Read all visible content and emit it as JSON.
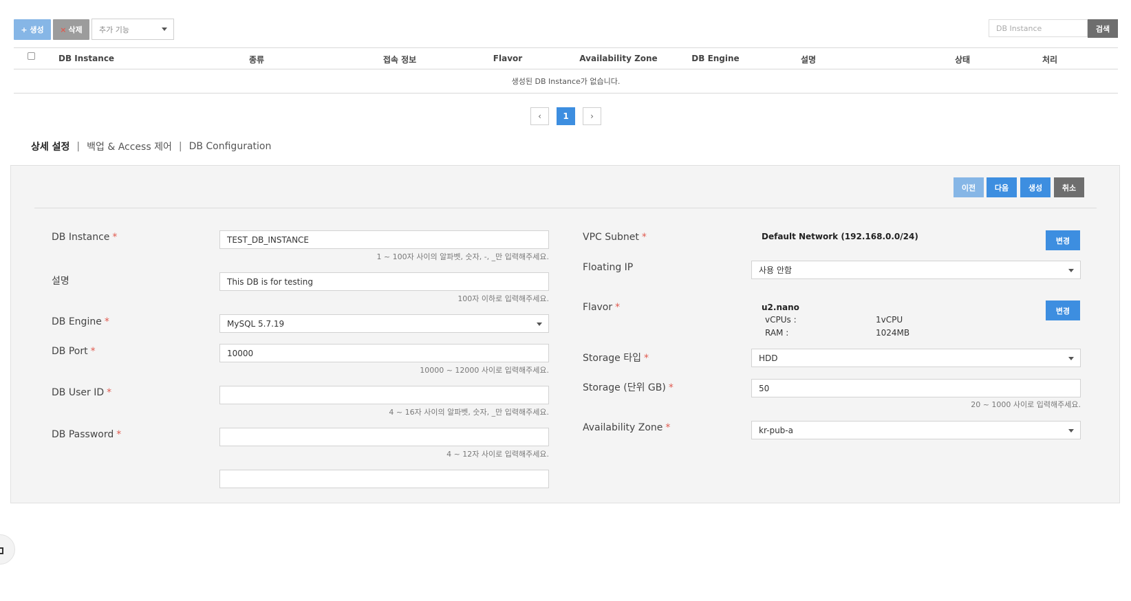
{
  "toolbar": {
    "create_label": "+ 생성",
    "delete_label": "삭제",
    "delete_x": "×",
    "extra_select": "추가 기능",
    "search_placeholder": "DB Instance",
    "search_button": "검색"
  },
  "table": {
    "columns": [
      "DB Instance",
      "종류",
      "접속 정보",
      "Flavor",
      "Availability Zone",
      "DB Engine",
      "설명",
      "상태",
      "처리"
    ],
    "empty_message": "생성된 DB Instance가 없습니다."
  },
  "pagination": {
    "prev": "‹",
    "current": "1",
    "next": "›"
  },
  "tabs": [
    "상세 설정",
    "백업 & Access 제어",
    "DB Configuration"
  ],
  "tab_separator": "|",
  "required_mark": "*",
  "actions": {
    "prev": "이전",
    "next": "다음",
    "create": "생성",
    "cancel": "취소"
  },
  "form_left": {
    "instance_label": "DB Instance",
    "instance_value": "TEST_DB_INSTANCE",
    "instance_hint": "1 ~ 100자 사이의 알파벳, 숫자, -, _만 입력해주세요.",
    "desc_label": "설명",
    "desc_value": "This DB is for testing",
    "desc_hint": "100자 이하로 입력해주세요.",
    "engine_label": "DB Engine",
    "engine_value": "MySQL 5.7.19",
    "port_label": "DB Port",
    "port_value": "10000",
    "port_hint": "10000 ~ 12000 사이로 입력해주세요.",
    "userid_label": "DB User ID",
    "userid_value": "",
    "userid_hint": "4 ~ 16자 사이의 알파벳, 숫자, _만 입력해주세요.",
    "password_label": "DB Password",
    "password_value": "",
    "password_hint": "4 ~ 12자 사이로 입력해주세요.",
    "password_confirm_value": ""
  },
  "form_right": {
    "vpc_label": "VPC Subnet",
    "vpc_value": "Default Network (192.168.0.0/24)",
    "change_label": "변경",
    "floating_label": "Floating IP",
    "floating_value": "사용 안함",
    "flavor_label": "Flavor",
    "flavor_name": "u2.nano",
    "vcpus_label": "vCPUs :",
    "vcpus_value": "1vCPU",
    "ram_label": "RAM :",
    "ram_value": "1024MB",
    "storage_type_label": "Storage 타입",
    "storage_type_value": "HDD",
    "storage_size_label": "Storage (단위 GB)",
    "storage_size_value": "50",
    "storage_size_hint": "20 ~ 1000 사이로 입력해주세요.",
    "az_label": "Availability Zone",
    "az_value": "kr-pub-a"
  },
  "colors": {
    "primary": "#3d8ee0",
    "primary_light": "#86b6e6",
    "grey_button": "#9c9c9c",
    "dark_button": "#6e6e6e",
    "required": "#e05a4f",
    "panel_bg": "#f4f4f4"
  }
}
